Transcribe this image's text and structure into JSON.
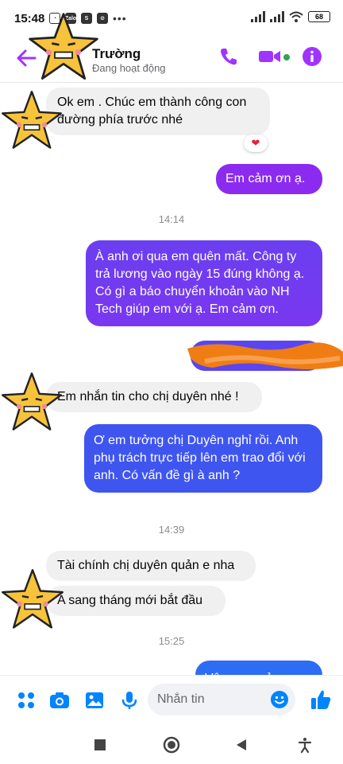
{
  "status_bar": {
    "time": "15:48",
    "signal": "signal-icon",
    "battery": "68"
  },
  "header": {
    "contact_name": "Trường",
    "contact_status": "Đang hoạt động",
    "accent": "#a033ff"
  },
  "messages": [
    {
      "side": "in",
      "text": "Ok em . Chúc em thành công con đường phía trước nhé"
    },
    {
      "side": "out",
      "text": "Em cảm ơn ạ."
    },
    {
      "side": "out",
      "text": "À anh ơi qua em quên mất. Công ty trả lương vào ngày 15 đúng không ạ. Có gì a báo chuyển khoản vào NH Tech giúp em với ạ. Em cảm ơn."
    },
    {
      "side": "in",
      "text": "Em nhắn tin cho chị duyên nhé !"
    },
    {
      "side": "out",
      "text": "Ơ em tưởng chị Duyên nghỉ rồi. Anh phụ trách trực tiếp lên em trao đổi với anh. Có vấn đề gì à anh ?"
    },
    {
      "side": "in",
      "text": "Tài chính chị duyên quản e nha"
    },
    {
      "side": "in",
      "text": "A sang tháng mới bắt đầu"
    },
    {
      "side": "out",
      "text": "Vâng em cảm ơn"
    }
  ],
  "timestamps": [
    "14:14",
    "14:39",
    "15:25"
  ],
  "reaction": "❤",
  "composer": {
    "placeholder": "Nhắn tin"
  },
  "colors": {
    "bubble_purple": "#8b2bf0",
    "bubble_violet": "#6a3cf0",
    "bubble_blue": "#3f55f0",
    "bubble_in": "#f0f0f0",
    "scribble": "#f07d14",
    "star": "#f7c33a"
  }
}
